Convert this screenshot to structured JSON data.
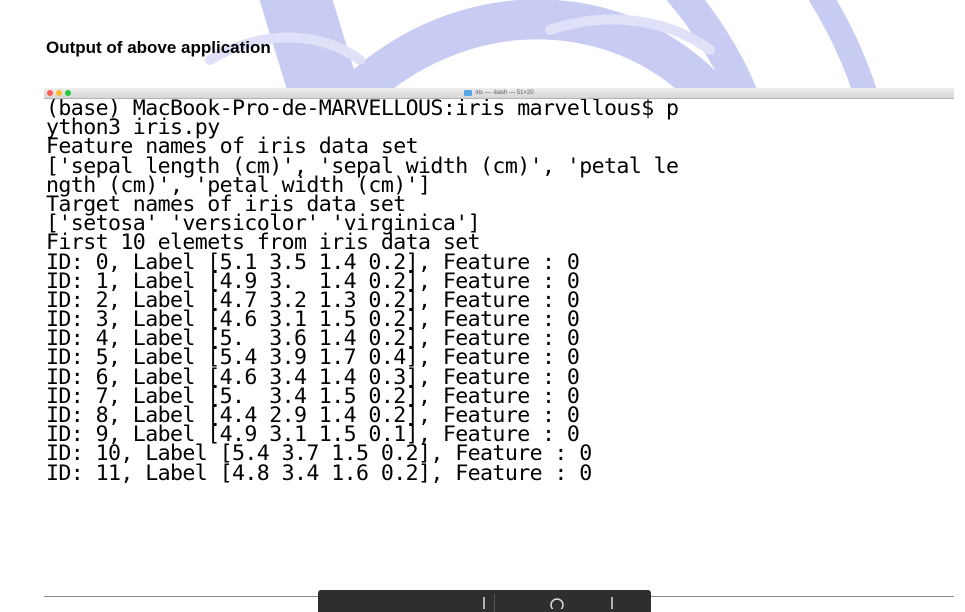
{
  "heading": "Output of above application",
  "terminal": {
    "title": "iris — -bash — 51×20",
    "lines": [
      "(base) MacBook-Pro-de-MARVELLOUS:iris marvellous$ p",
      "ython3 iris.py",
      "Feature names of iris data set",
      "['sepal length (cm)', 'sepal width (cm)', 'petal le",
      "ngth (cm)', 'petal width (cm)']",
      "Target names of iris data set",
      "['setosa' 'versicolor' 'virginica']",
      "First 10 elemets from iris data set",
      "ID: 0, Label [5.1 3.5 1.4 0.2], Feature : 0",
      "ID: 1, Label [4.9 3.  1.4 0.2], Feature : 0",
      "ID: 2, Label [4.7 3.2 1.3 0.2], Feature : 0",
      "ID: 3, Label [4.6 3.1 1.5 0.2], Feature : 0",
      "ID: 4, Label [5.  3.6 1.4 0.2], Feature : 0",
      "ID: 5, Label [5.4 3.9 1.7 0.4], Feature : 0",
      "ID: 6, Label [4.6 3.4 1.4 0.3], Feature : 0",
      "ID: 7, Label [5.  3.4 1.5 0.2], Feature : 0",
      "ID: 8, Label [4.4 2.9 1.4 0.2], Feature : 0",
      "ID: 9, Label [4.9 3.1 1.5 0.1], Feature : 0",
      "ID: 10, Label [5.4 3.7 1.5 0.2], Feature : 0",
      "ID: 11, Label [4.8 3.4 1.6 0.2], Feature : 0"
    ]
  },
  "colors": {
    "watermark": "#c9ccf2",
    "traffic_close": "#fc5f57",
    "traffic_minimize": "#fdbc2e",
    "traffic_maximize": "#28c840",
    "toolbar": "#2e2e2e"
  },
  "toolbar": {
    "left_icon": "zoom-out-icon",
    "right_icon": "search-icon"
  }
}
